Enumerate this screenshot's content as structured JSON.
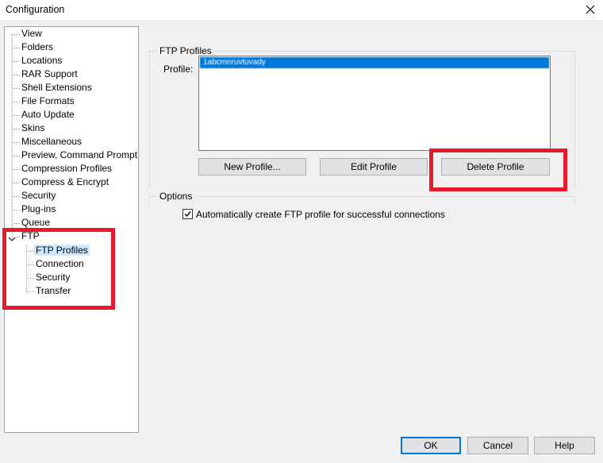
{
  "window": {
    "title": "Configuration",
    "close_icon": "close-icon"
  },
  "tree": {
    "items": [
      {
        "label": "View"
      },
      {
        "label": "Folders"
      },
      {
        "label": "Locations"
      },
      {
        "label": "RAR Support"
      },
      {
        "label": "Shell Extensions"
      },
      {
        "label": "File Formats"
      },
      {
        "label": "Auto Update"
      },
      {
        "label": "Skins"
      },
      {
        "label": "Miscellaneous"
      },
      {
        "label": "Preview, Command Prompt"
      },
      {
        "label": "Compression Profiles"
      },
      {
        "label": "Compress & Encrypt"
      },
      {
        "label": "Security"
      },
      {
        "label": "Plug-ins"
      },
      {
        "label": "Queue"
      },
      {
        "label": "FTP",
        "expanded": true
      }
    ],
    "ftp_children": [
      {
        "label": "FTP Profiles",
        "selected": true
      },
      {
        "label": "Connection"
      },
      {
        "label": "Security"
      },
      {
        "label": "Transfer"
      }
    ]
  },
  "ftp_profiles": {
    "group_title": "FTP Profiles",
    "profile_label": "Profile:",
    "selected_profile": "1abcmnruvtuvady",
    "buttons": {
      "new": "New Profile...",
      "edit": "Edit Profile",
      "delete": "Delete Profile"
    }
  },
  "options": {
    "group_title": "Options",
    "auto_create_label": "Automatically create FTP profile for successful connections",
    "auto_create_checked": true
  },
  "footer": {
    "ok": "OK",
    "cancel": "Cancel",
    "help": "Help"
  },
  "colors": {
    "highlight": "#e8192c",
    "selection": "#0078d7",
    "tree_selection": "#cce8ff"
  }
}
